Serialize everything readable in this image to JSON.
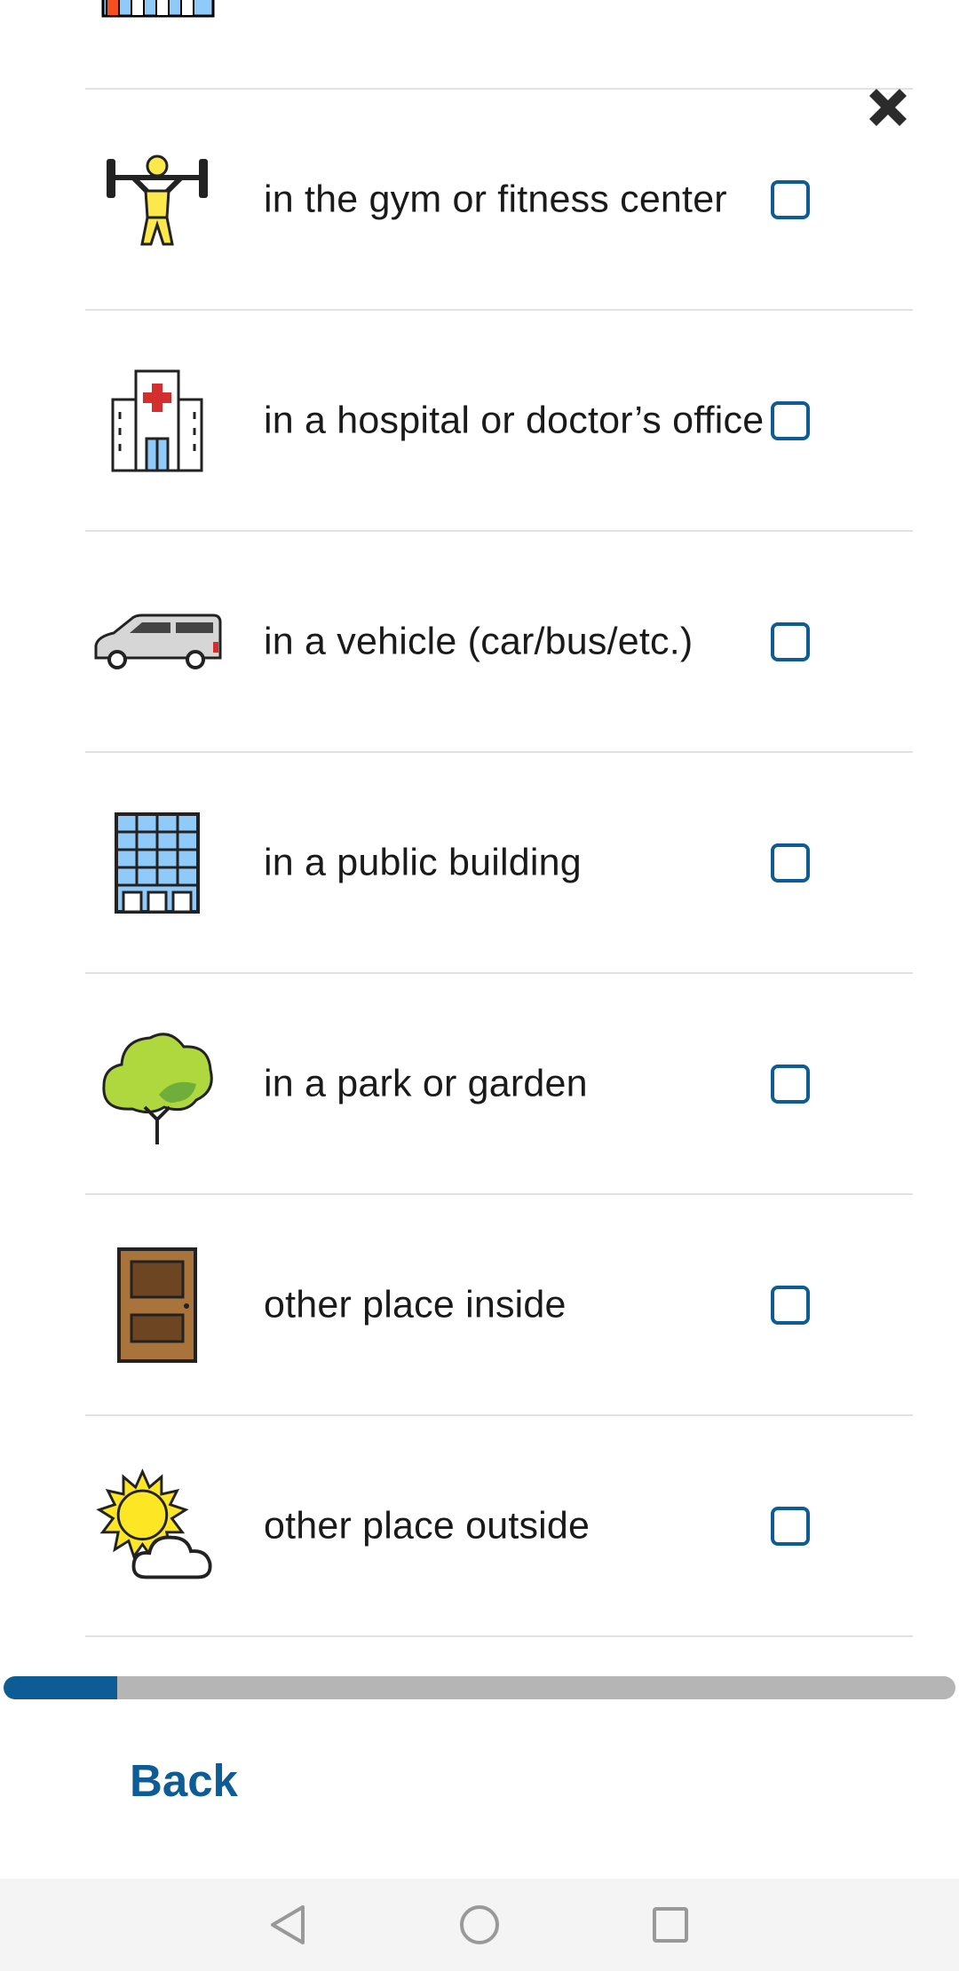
{
  "close_icon": "close-icon",
  "items": [
    {
      "label": "in the gym or fitness center",
      "icon": "weightlifter-icon",
      "checked": false
    },
    {
      "label": "in a hospital or doctor’s office",
      "icon": "hospital-icon",
      "checked": false
    },
    {
      "label": "in a vehicle (car/bus/etc.)",
      "icon": "van-icon",
      "checked": false
    },
    {
      "label": "in a public building",
      "icon": "office-building-icon",
      "checked": false
    },
    {
      "label": "in a park or garden",
      "icon": "tree-icon",
      "checked": false
    },
    {
      "label": "other place inside",
      "icon": "door-icon",
      "checked": false
    },
    {
      "label": "other place outside",
      "icon": "sun-behind-cloud-icon",
      "checked": false
    }
  ],
  "progress": {
    "fraction": 0.119
  },
  "back_label": "Back",
  "colors": {
    "accent": "#0d5c96",
    "progress_track": "#b5b5b5",
    "divider": "#e2e2e2"
  },
  "nav": {
    "icons": [
      "back-triangle-icon",
      "home-circle-icon",
      "recents-square-icon"
    ]
  }
}
